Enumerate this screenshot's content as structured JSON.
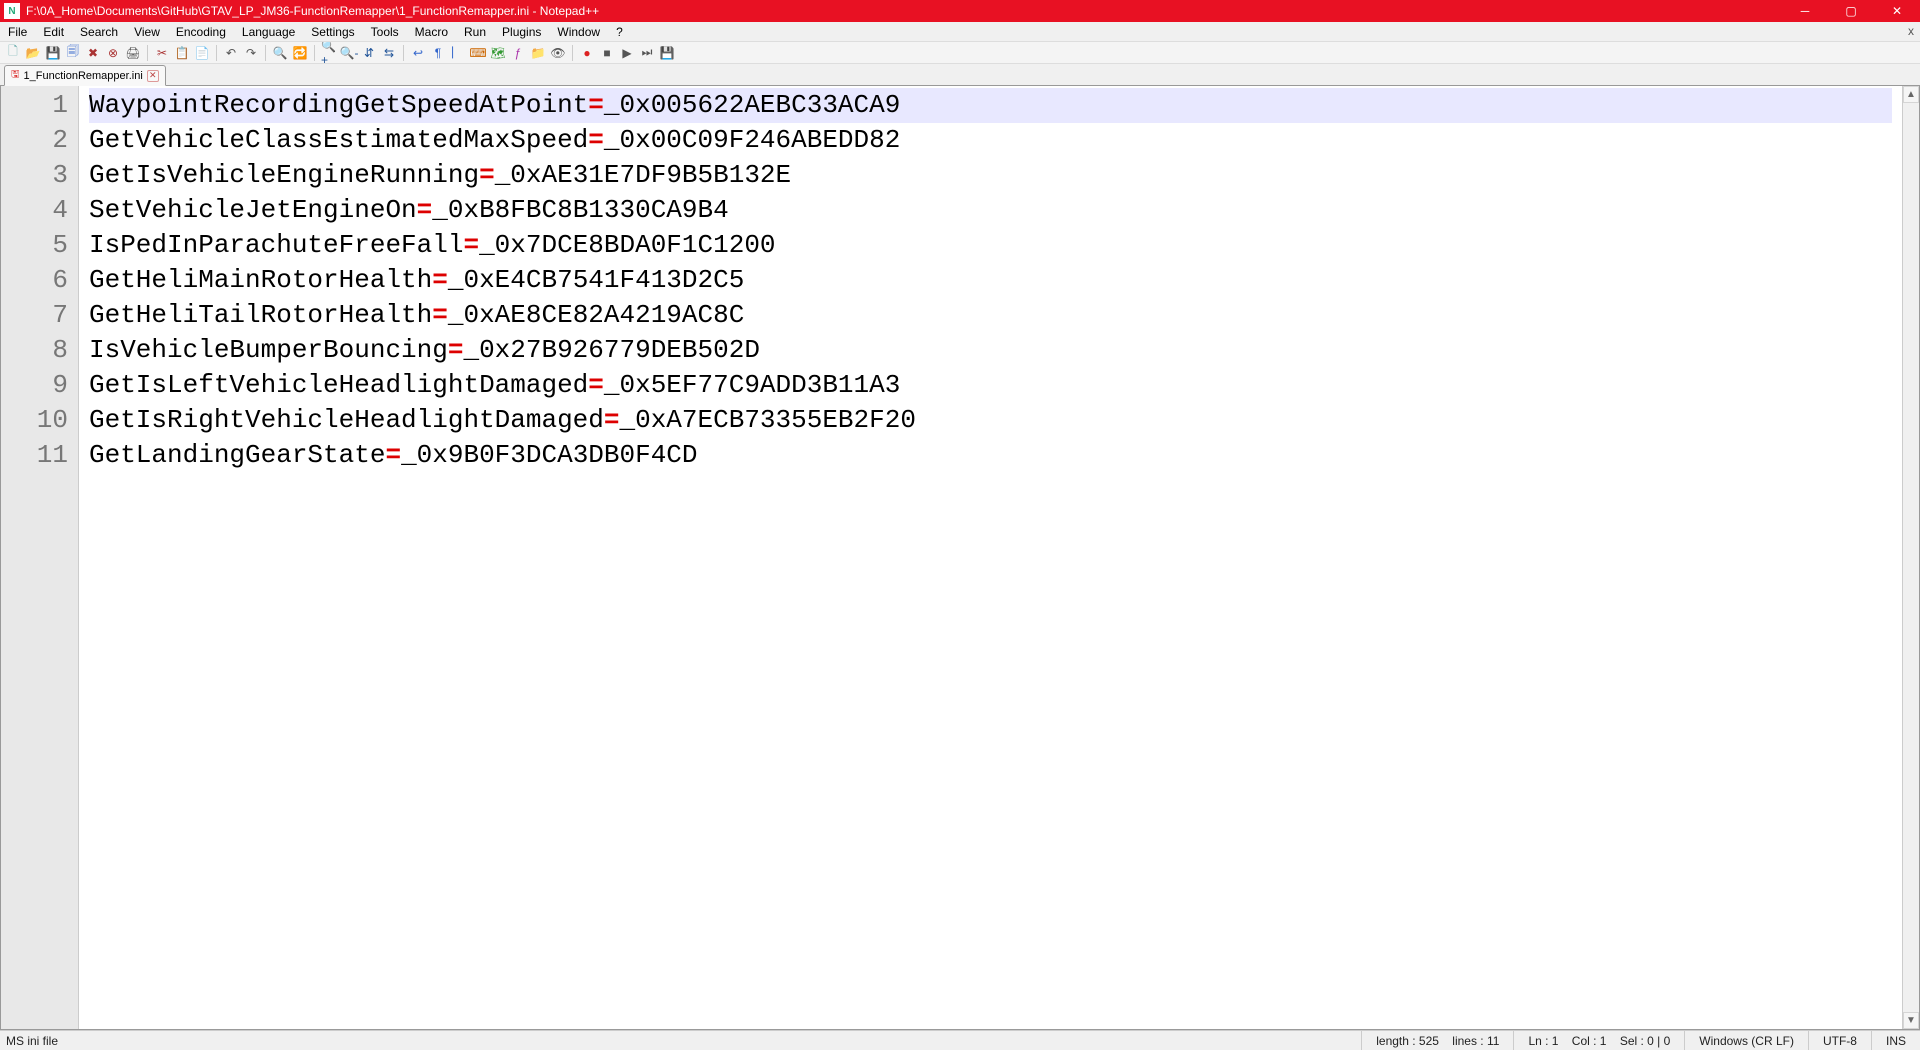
{
  "window": {
    "title": "F:\\0A_Home\\Documents\\GitHub\\GTAV_LP_JM36-FunctionRemapper\\1_FunctionRemapper.ini - Notepad++"
  },
  "menu": {
    "items": [
      "File",
      "Edit",
      "Search",
      "View",
      "Encoding",
      "Language",
      "Settings",
      "Tools",
      "Macro",
      "Run",
      "Plugins",
      "Window",
      "?"
    ]
  },
  "toolbar": {
    "icons": [
      {
        "name": "new-file-icon",
        "glyph": "🗋",
        "color": "#6aa"
      },
      {
        "name": "open-file-icon",
        "glyph": "📂",
        "color": "#e90"
      },
      {
        "name": "save-icon",
        "glyph": "💾",
        "color": "#36c"
      },
      {
        "name": "save-all-icon",
        "glyph": "🗐",
        "color": "#36c"
      },
      {
        "name": "close-file-icon",
        "glyph": "✖",
        "color": "#a33"
      },
      {
        "name": "close-all-icon",
        "glyph": "⊗",
        "color": "#a33"
      },
      {
        "name": "print-icon",
        "glyph": "🖨",
        "color": "#555"
      },
      {
        "sep": true
      },
      {
        "name": "cut-icon",
        "glyph": "✂",
        "color": "#a33"
      },
      {
        "name": "copy-icon",
        "glyph": "📋",
        "color": "#36c"
      },
      {
        "name": "paste-icon",
        "glyph": "📄",
        "color": "#a80"
      },
      {
        "sep": true
      },
      {
        "name": "undo-icon",
        "glyph": "↶",
        "color": "#555"
      },
      {
        "name": "redo-icon",
        "glyph": "↷",
        "color": "#555"
      },
      {
        "sep": true
      },
      {
        "name": "find-icon",
        "glyph": "🔍",
        "color": "#a80"
      },
      {
        "name": "replace-icon",
        "glyph": "🔁",
        "color": "#a80"
      },
      {
        "sep": true
      },
      {
        "name": "zoom-in-icon",
        "glyph": "🔍+",
        "color": "#259"
      },
      {
        "name": "zoom-out-icon",
        "glyph": "🔍-",
        "color": "#259"
      },
      {
        "name": "sync-v-icon",
        "glyph": "⇵",
        "color": "#259"
      },
      {
        "name": "sync-h-icon",
        "glyph": "⇆",
        "color": "#259"
      },
      {
        "sep": true
      },
      {
        "name": "word-wrap-icon",
        "glyph": "↩",
        "color": "#36c"
      },
      {
        "name": "all-chars-icon",
        "glyph": "¶",
        "color": "#36c"
      },
      {
        "name": "indent-guide-icon",
        "glyph": "⎸",
        "color": "#36c"
      },
      {
        "name": "lang-icon",
        "glyph": "⌨",
        "color": "#c60"
      },
      {
        "name": "doc-map-icon",
        "glyph": "🗺",
        "color": "#393"
      },
      {
        "name": "func-list-icon",
        "glyph": "ƒ",
        "color": "#a3a"
      },
      {
        "name": "folder-tree-icon",
        "glyph": "📁",
        "color": "#e80"
      },
      {
        "name": "monitor-icon",
        "glyph": "👁",
        "color": "#555"
      },
      {
        "sep": true
      },
      {
        "name": "record-macro-icon",
        "glyph": "●",
        "color": "#d22"
      },
      {
        "name": "stop-macro-icon",
        "glyph": "■",
        "color": "#555"
      },
      {
        "name": "play-macro-icon",
        "glyph": "▶",
        "color": "#555"
      },
      {
        "name": "play-multi-icon",
        "glyph": "⏭",
        "color": "#555"
      },
      {
        "name": "save-macro-icon",
        "glyph": "💾",
        "color": "#555"
      }
    ]
  },
  "tabs": {
    "items": [
      {
        "label": "1_FunctionRemapper.ini",
        "active": true
      }
    ]
  },
  "editor": {
    "current_line": 1,
    "lines": [
      {
        "key": "WaypointRecordingGetSpeedAtPoint",
        "value": "_0x005622AEBC33ACA9"
      },
      {
        "key": "GetVehicleClassEstimatedMaxSpeed",
        "value": "_0x00C09F246ABEDD82"
      },
      {
        "key": "GetIsVehicleEngineRunning",
        "value": "_0xAE31E7DF9B5B132E"
      },
      {
        "key": "SetVehicleJetEngineOn",
        "value": "_0xB8FBC8B1330CA9B4"
      },
      {
        "key": "IsPedInParachuteFreeFall",
        "value": "_0x7DCE8BDA0F1C1200"
      },
      {
        "key": "GetHeliMainRotorHealth",
        "value": "_0xE4CB7541F413D2C5"
      },
      {
        "key": "GetHeliTailRotorHealth",
        "value": "_0xAE8CE82A4219AC8C"
      },
      {
        "key": "IsVehicleBumperBouncing",
        "value": "_0x27B926779DEB502D"
      },
      {
        "key": "GetIsLeftVehicleHeadlightDamaged",
        "value": "_0x5EF77C9ADD3B11A3"
      },
      {
        "key": "GetIsRightVehicleHeadlightDamaged",
        "value": "_0xA7ECB73355EB2F20"
      },
      {
        "key": "GetLandingGearState",
        "value": "_0x9B0F3DCA3DB0F4CD"
      }
    ]
  },
  "status": {
    "filetype": "MS ini file",
    "length_label": "length : 525",
    "lines_label": "lines : 11",
    "pos_label": "Ln : 1    Col : 1    Sel : 0 | 0",
    "eol": "Windows (CR LF)",
    "encoding": "UTF-8",
    "mode": "INS"
  }
}
